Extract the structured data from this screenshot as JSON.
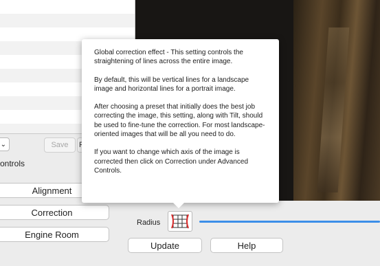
{
  "left_panel": {
    "rows": 10,
    "select_arrow": "⌄",
    "save_label": "Save",
    "save_label_2": "R",
    "section_label": "ontrols",
    "buttons": {
      "alignment": "Alignment",
      "correction": "Correction",
      "engine_room": "Engine Room"
    }
  },
  "tooltip": {
    "paragraphs": [
      "Global correction effect - This setting controls the straightening of lines across the entire image.",
      "By default, this will be vertical lines for a landscape image and horizontal lines for a portrait image.",
      "After choosing a preset that initially does the best job correcting the image, this setting, along with Tilt, should be used to fine-tune the correction. For most landscape-oriented images that will be all you need to do.",
      "If you want to change which axis of the image is corrected then click on Correction under Advanced Controls."
    ]
  },
  "controls": {
    "radius_label": "Radius",
    "radius_icon": "grid-distortion-icon",
    "accent_color": "#3b8ee8",
    "update_label": "Update",
    "help_label": "Help"
  }
}
